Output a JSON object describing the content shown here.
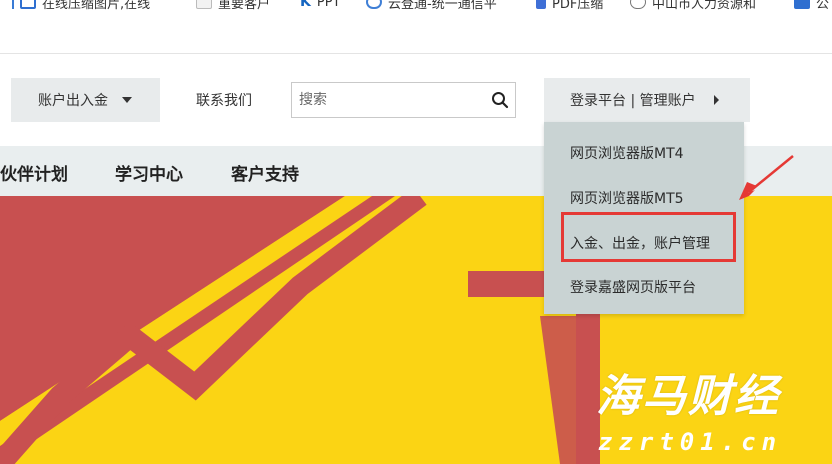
{
  "bookmarks": [
    {
      "label": "在线压缩图片,在线",
      "icon": "image-compress-icon"
    },
    {
      "label": "重要客户",
      "icon": "folder-icon"
    },
    {
      "label": "PPT",
      "icon": "ppt-icon"
    },
    {
      "label": "云登通-统一通信平",
      "icon": "cloud-icon"
    },
    {
      "label": "PDF压缩",
      "icon": "pdf-icon"
    },
    {
      "label": "中山市人力资源和",
      "icon": "globe-icon"
    },
    {
      "label": "公",
      "icon": "app-icon"
    }
  ],
  "header": {
    "account_button": "账户出入金",
    "contact_link": "联系我们",
    "search_placeholder": "搜索",
    "login_button": "登录平台 | 管理账户"
  },
  "nav": {
    "items": [
      "伙伴计划",
      "学习中心",
      "客户支持"
    ]
  },
  "dropdown": {
    "items": [
      "网页浏览器版MT4",
      "网页浏览器版MT5",
      "入金、出金，账户管理",
      "登录嘉盛网页版平台"
    ],
    "highlighted_index": 2
  },
  "watermark": {
    "title": "海马财经",
    "subtitle": "zzrt01.cn"
  },
  "colors": {
    "hero_yellow": "#fbd414",
    "hero_red": "#c85050",
    "highlight_red": "#e53935",
    "dropdown_bg": "#c9d3d3"
  }
}
